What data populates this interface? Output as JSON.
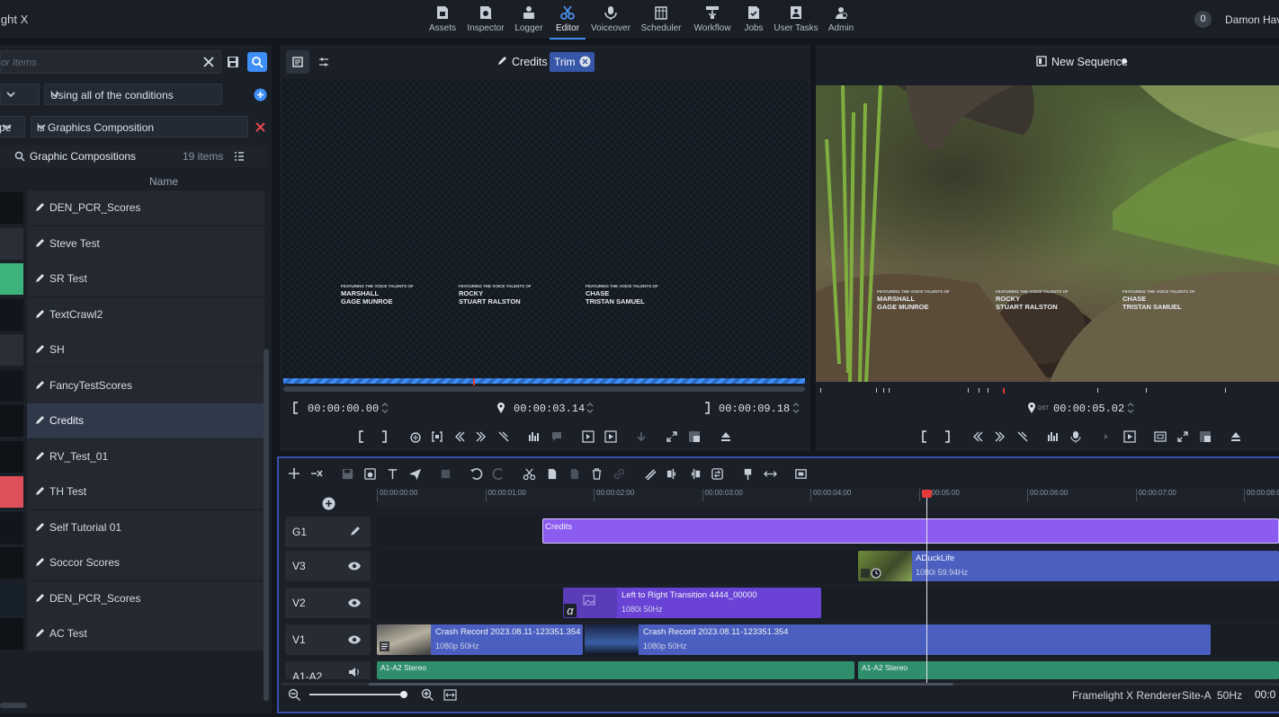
{
  "app": {
    "title": "ight X"
  },
  "nav": [
    {
      "label": "Assets",
      "icon": "assets-icon"
    },
    {
      "label": "Inspector",
      "icon": "inspector-icon"
    },
    {
      "label": "Logger",
      "icon": "logger-icon"
    },
    {
      "label": "Editor",
      "icon": "editor-icon",
      "active": true
    },
    {
      "label": "Voiceover",
      "icon": "voiceover-icon"
    },
    {
      "label": "Scheduler",
      "icon": "scheduler-icon"
    },
    {
      "label": "Workflow",
      "icon": "workflow-icon"
    },
    {
      "label": "Jobs",
      "icon": "jobs-icon"
    },
    {
      "label": "User Tasks",
      "icon": "user-tasks-icon"
    },
    {
      "label": "Admin",
      "icon": "admin-icon"
    }
  ],
  "header": {
    "notification_count": "0",
    "user_name": "Damon Hav"
  },
  "left": {
    "search_placeholder": "or Items",
    "condition_mode": "Using all of the conditions",
    "condition_field": "pe",
    "condition_value": "is Graphics Composition",
    "collection": {
      "name": "Graphic Compositions",
      "count": "19 items"
    },
    "column_name": "Name",
    "items": [
      {
        "name": "DEN_PCR_Scores",
        "thumb": "#0f1216"
      },
      {
        "name": "Steve Test",
        "thumb": "#2a2f37"
      },
      {
        "name": "SR Test",
        "thumb": "#3bb37a"
      },
      {
        "name": "TextCrawl2",
        "thumb": "#11161c"
      },
      {
        "name": "SH",
        "thumb": "#2a2f37"
      },
      {
        "name": "FancyTestScores",
        "thumb": "#11161c"
      },
      {
        "name": "Credits",
        "thumb": "#0f1216",
        "selected": true
      },
      {
        "name": "RV_Test_01",
        "thumb": "#0f1216"
      },
      {
        "name": "TH Test",
        "thumb": "#e0505a"
      },
      {
        "name": "Self Tutorial 01",
        "thumb": "#11161c"
      },
      {
        "name": "Soccor Scores",
        "thumb": "#0f1216"
      },
      {
        "name": "DEN_PCR_Scores",
        "thumb": "#15222c"
      },
      {
        "name": "AC Test",
        "thumb": "#0f1216"
      }
    ]
  },
  "source": {
    "title": "Credits",
    "mode_chip": "Trim",
    "credits_header": "FEATURING THE VOICE TALENTS OF",
    "credits": [
      {
        "role": "MARSHALL",
        "actor": "GAGE MUNROE"
      },
      {
        "role": "ROCKY",
        "actor": "STUART RALSTON"
      },
      {
        "role": "CHASE",
        "actor": "TRISTAN SAMUEL"
      }
    ],
    "in_tc": "00:00:00.00",
    "current_tc": "00:00:03.14",
    "out_tc": "00:00:09.18"
  },
  "program": {
    "title": "New Sequence",
    "current_tc": "00:00:05.02",
    "tc_prefix": "DST"
  },
  "timeline": {
    "ruler": [
      "00:00:00:00",
      "00:00:01:00",
      "00:00:02:00",
      "00:00:03:00",
      "00:00:04:00",
      "00:00:05:00",
      "00:00:06:00",
      "00:00:07:00",
      "00:00:08:0"
    ],
    "tracks": [
      "G1",
      "V3",
      "V2",
      "V1",
      "A1-A2"
    ],
    "clips": {
      "g1": {
        "name": "Credits"
      },
      "v3": {
        "name": "ADuckLife",
        "spec": "1080i 59.94Hz"
      },
      "v2": {
        "name": "Left to Right Transition 4444_00000",
        "spec": "1080i 50Hz",
        "badge": "α"
      },
      "v1a": {
        "name": "Crash Record 2023.08.11-123351.354",
        "spec": "1080p 50Hz"
      },
      "v1b": {
        "name": "Crash Record 2023.08.11-123351.354",
        "spec": "1080p 50Hz"
      },
      "a1a": {
        "name": "A1-A2 Stereo"
      },
      "a1b": {
        "name": "A1-A2 Stereo"
      }
    }
  },
  "status": {
    "renderer": "Framelight X Renderer",
    "site": "Site-A",
    "rate": "50Hz",
    "tc": "00:0"
  },
  "colors": {
    "accent": "#3e8ef7",
    "graphics_clip": "#8c5cf0",
    "video_clip": "#4a5fc0",
    "audio_clip": "#2f8f6c",
    "playhead": "#e33a3a"
  }
}
